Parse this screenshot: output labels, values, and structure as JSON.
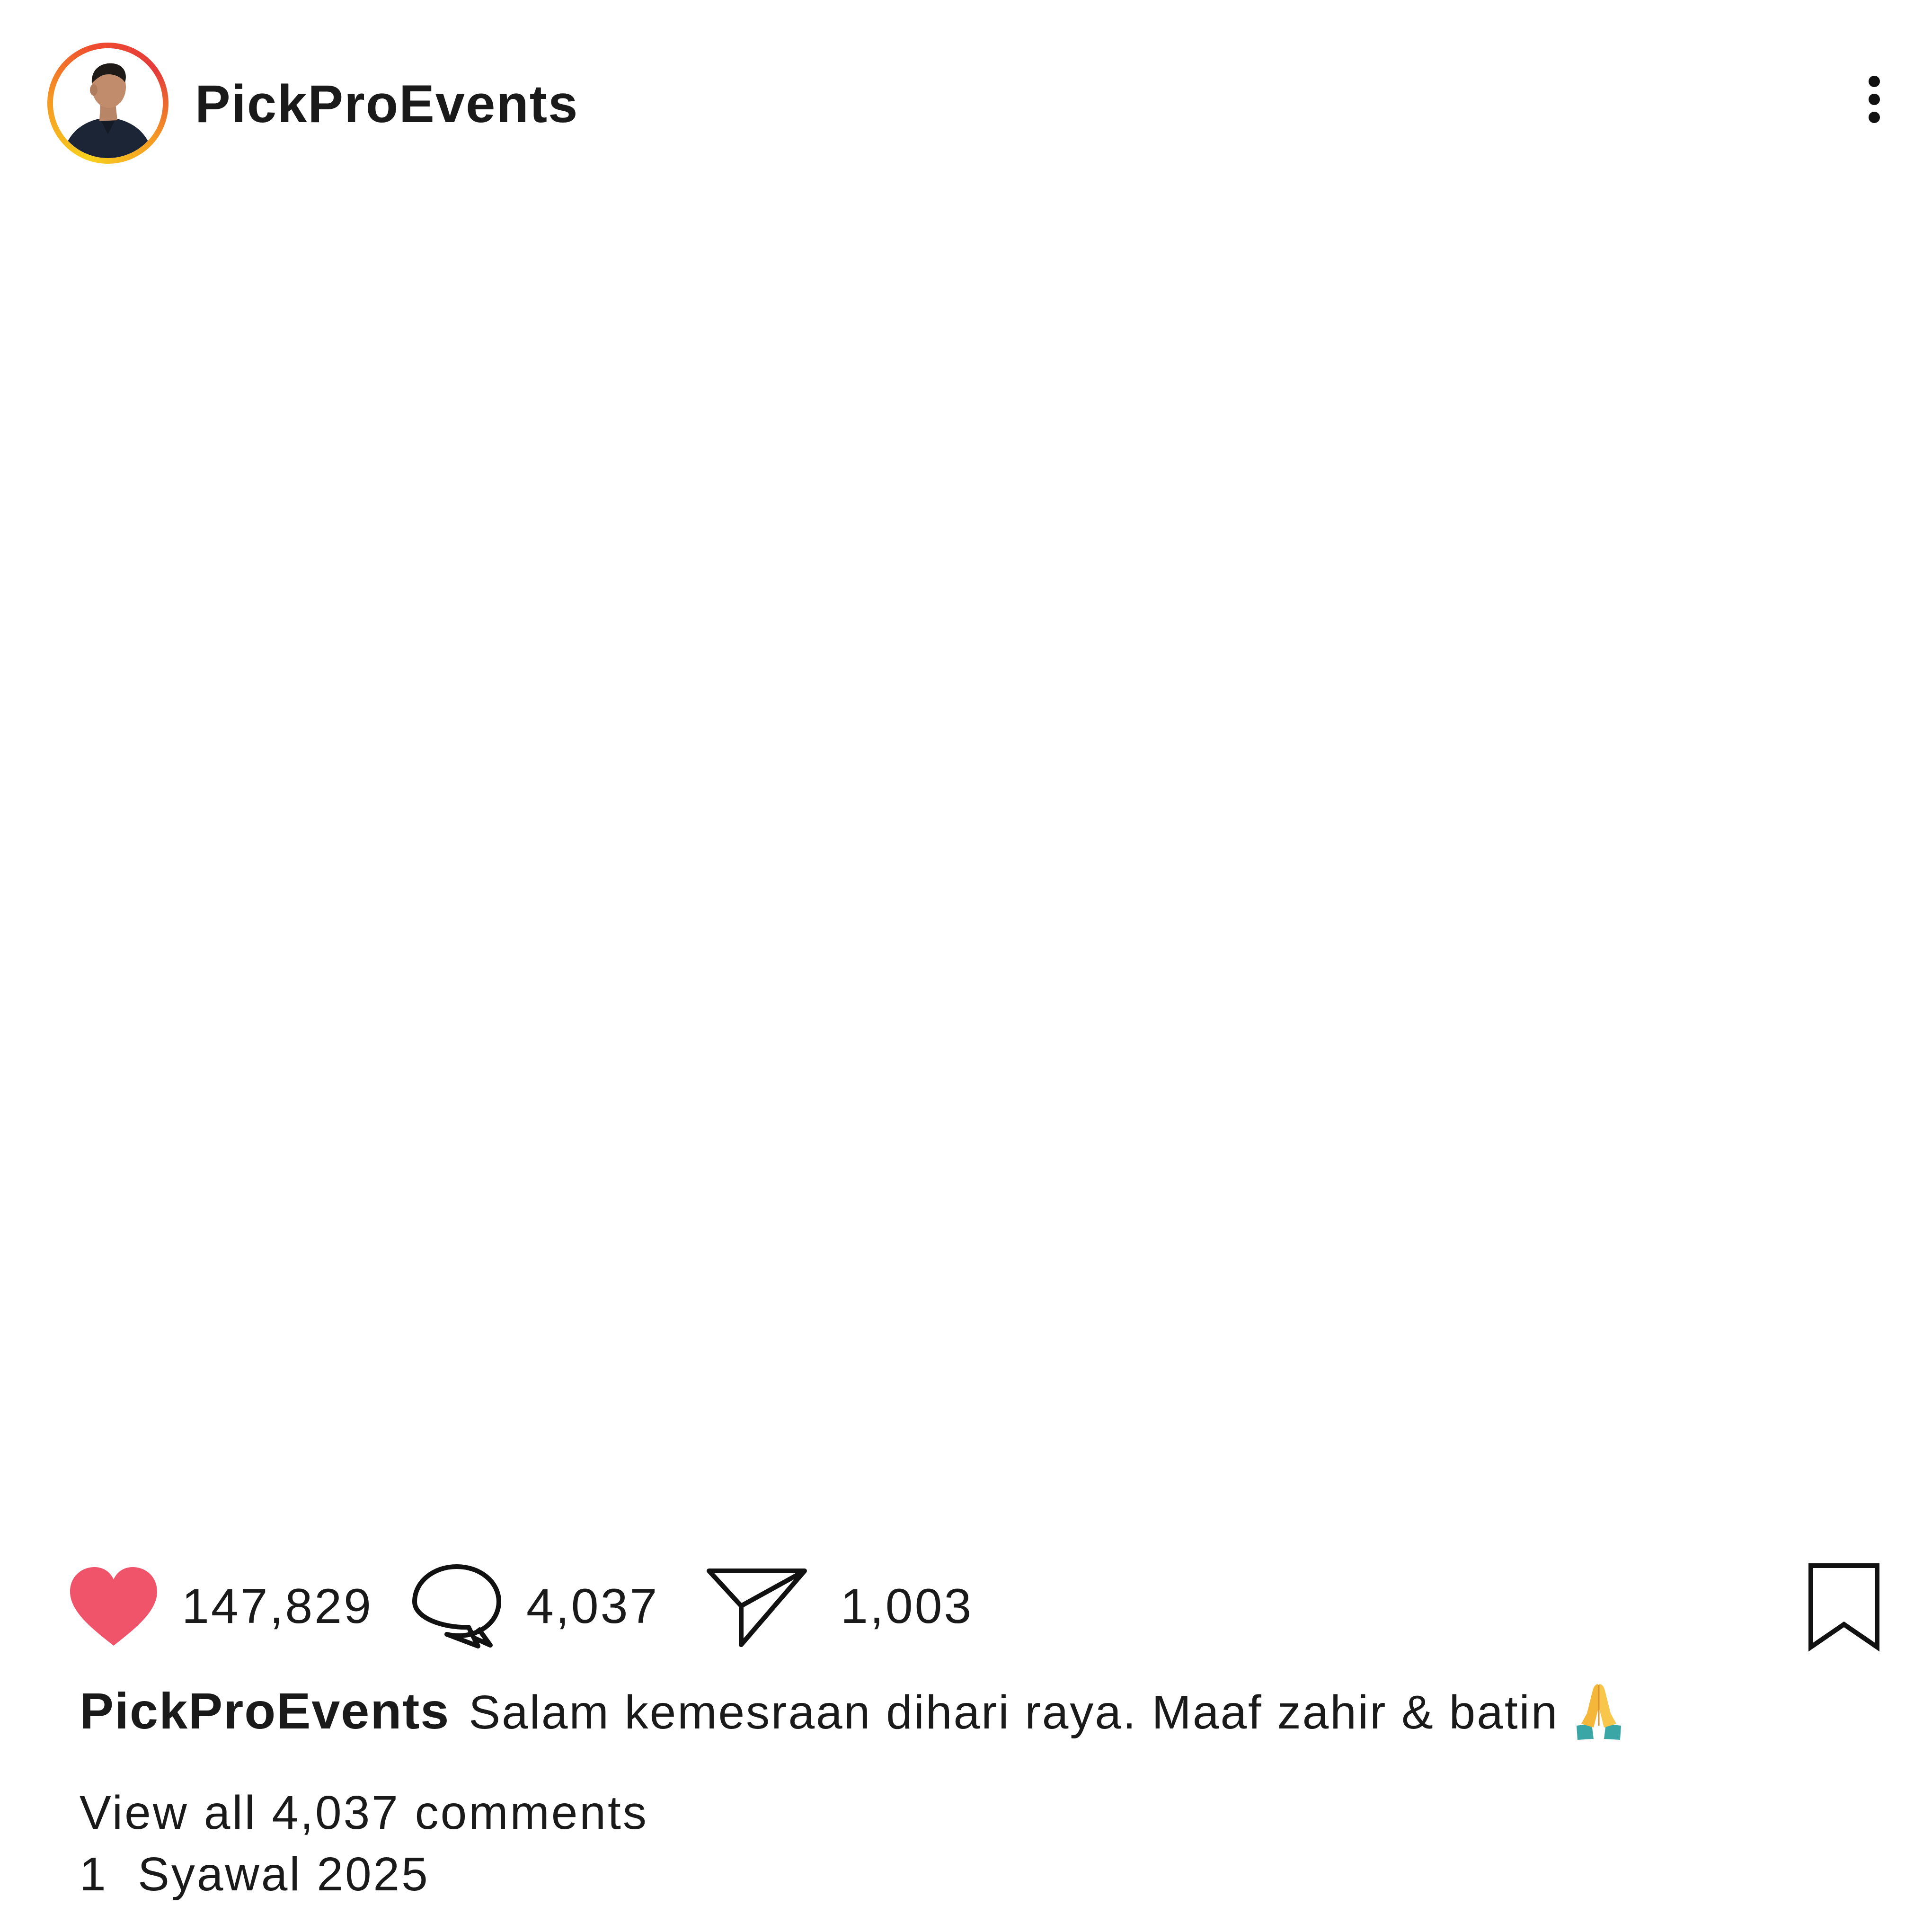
{
  "header": {
    "username": "PickProEvents",
    "avatar_icon": "profile-photo-man-looking-up",
    "ring_colors": [
      "#f7d11e",
      "#f59a23",
      "#ef4d2f"
    ],
    "more_icon": "vertical-ellipsis-icon"
  },
  "actions": {
    "like": {
      "icon": "heart-icon",
      "count": "147,829",
      "color": "#f0546a"
    },
    "comment": {
      "icon": "speech-bubble-icon",
      "count": "4,037"
    },
    "share": {
      "icon": "paper-plane-icon",
      "count": "1,003"
    },
    "save": {
      "icon": "bookmark-icon"
    }
  },
  "caption": {
    "username": "PickProEvents",
    "text": "Salam kemesraan dihari raya. Maaf zahir & batin",
    "emoji": "folded-hands-emoji"
  },
  "comments": {
    "view_all_label": "View all 4,037 comments"
  },
  "post_date": "1  Syawal 2025"
}
